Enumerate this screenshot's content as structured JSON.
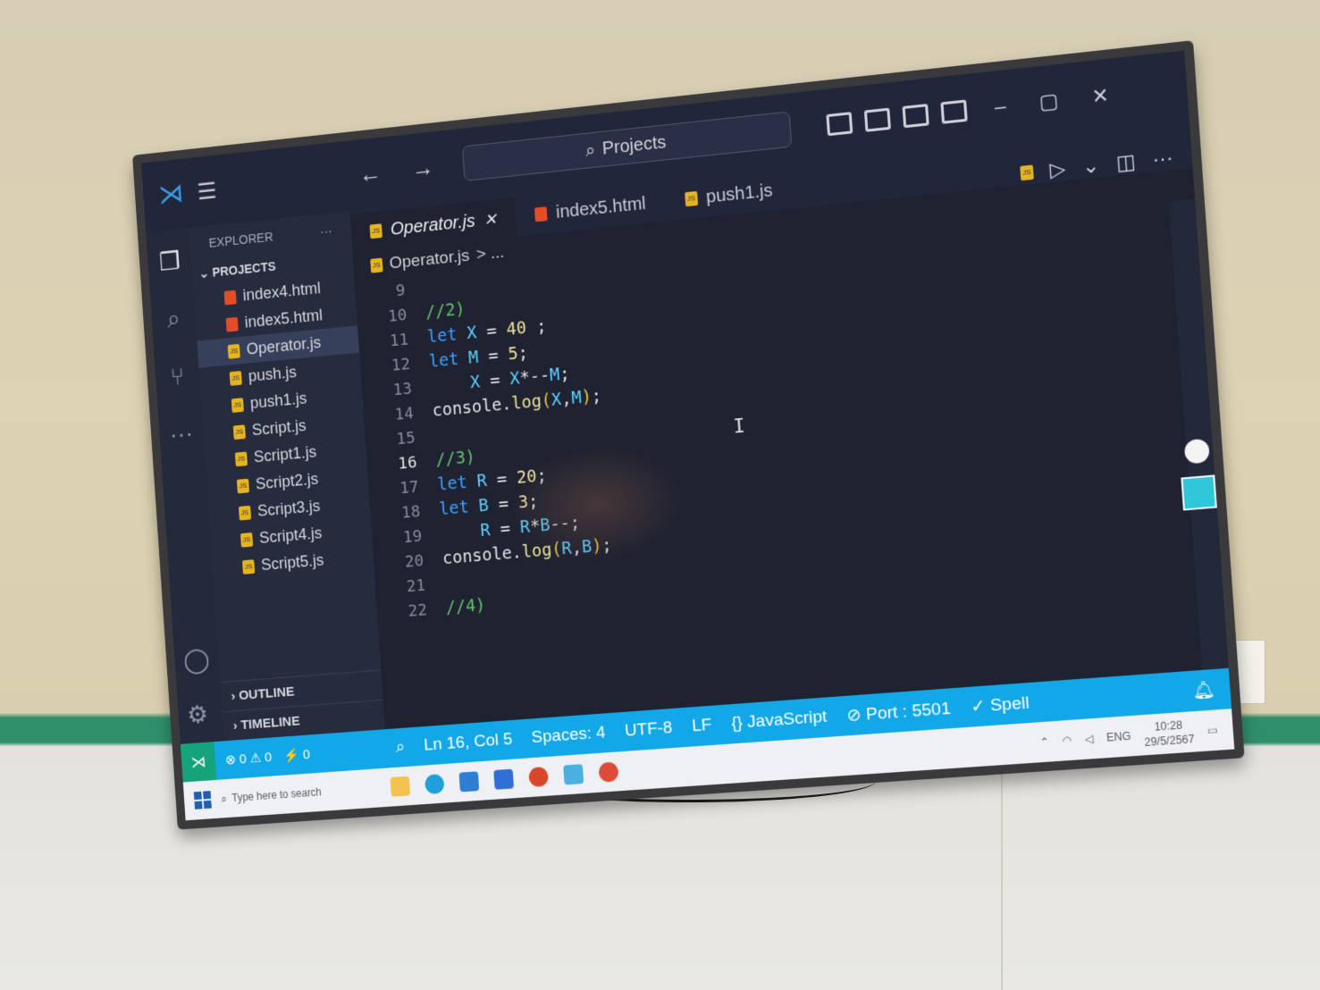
{
  "window": {
    "search_label": "Projects",
    "nav_arrows": "← →",
    "win_controls": [
      "–",
      "▢",
      "✕"
    ]
  },
  "explorer": {
    "title": "EXPLORER",
    "more": "···",
    "section": "PROJECTS",
    "files": [
      {
        "name": "index4.html",
        "type": "html"
      },
      {
        "name": "index5.html",
        "type": "html"
      },
      {
        "name": "Operator.js",
        "type": "js",
        "selected": true
      },
      {
        "name": "push.js",
        "type": "js"
      },
      {
        "name": "push1.js",
        "type": "js"
      },
      {
        "name": "Script.js",
        "type": "js"
      },
      {
        "name": "Script1.js",
        "type": "js"
      },
      {
        "name": "Script2.js",
        "type": "js"
      },
      {
        "name": "Script3.js",
        "type": "js"
      },
      {
        "name": "Script4.js",
        "type": "js"
      },
      {
        "name": "Script5.js",
        "type": "js"
      }
    ],
    "outline": "OUTLINE",
    "timeline": "TIMELINE"
  },
  "tabs": [
    {
      "label": "Operator.js",
      "close": "✕",
      "active": true
    },
    {
      "label": "index5.html"
    },
    {
      "label": "push1.js"
    }
  ],
  "breadcrumb": {
    "file": "Operator.js",
    "rest": "> ..."
  },
  "editor": {
    "lines": [
      {
        "n": "9",
        "parts": []
      },
      {
        "n": "10",
        "parts": [
          [
            "cmt",
            "//2)"
          ]
        ]
      },
      {
        "n": "11",
        "parts": [
          [
            "kw",
            "let "
          ],
          [
            "var",
            "X"
          ],
          [
            "",
            " = "
          ],
          [
            "num",
            "40"
          ],
          [
            "",
            " ;"
          ]
        ]
      },
      {
        "n": "12",
        "parts": [
          [
            "kw",
            "let "
          ],
          [
            "var",
            "M"
          ],
          [
            "",
            " = "
          ],
          [
            "num",
            "5"
          ],
          [
            "",
            ";"
          ]
        ]
      },
      {
        "n": "13",
        "parts": [
          [
            "",
            "    "
          ],
          [
            "var",
            "X"
          ],
          [
            "",
            " = "
          ],
          [
            "var",
            "X"
          ],
          [
            "",
            "*--"
          ],
          [
            "var",
            "M"
          ],
          [
            "",
            ";"
          ]
        ]
      },
      {
        "n": "14",
        "parts": [
          [
            "",
            "console."
          ],
          [
            "fn",
            "log"
          ],
          [
            "paren",
            "("
          ],
          [
            "var",
            "X"
          ],
          [
            "",
            ","
          ],
          [
            "var",
            "M"
          ],
          [
            "paren",
            ")"
          ],
          [
            "",
            ";"
          ]
        ]
      },
      {
        "n": "15",
        "parts": []
      },
      {
        "n": "16",
        "parts": [
          [
            "cmt",
            "//3)"
          ]
        ],
        "current": true
      },
      {
        "n": "17",
        "parts": [
          [
            "kw",
            "let "
          ],
          [
            "var",
            "R"
          ],
          [
            "",
            " = "
          ],
          [
            "num",
            "20"
          ],
          [
            "",
            ";"
          ]
        ]
      },
      {
        "n": "18",
        "parts": [
          [
            "kw",
            "let "
          ],
          [
            "var",
            "B"
          ],
          [
            "",
            " = "
          ],
          [
            "num",
            "3"
          ],
          [
            "",
            ";"
          ]
        ]
      },
      {
        "n": "19",
        "parts": [
          [
            "",
            "    "
          ],
          [
            "var",
            "R"
          ],
          [
            "",
            " = "
          ],
          [
            "var",
            "R"
          ],
          [
            "",
            "*"
          ],
          [
            "var",
            "B"
          ],
          [
            "",
            "--;"
          ]
        ]
      },
      {
        "n": "20",
        "parts": [
          [
            "",
            "console."
          ],
          [
            "fn",
            "log"
          ],
          [
            "paren",
            "("
          ],
          [
            "var",
            "R"
          ],
          [
            "",
            ","
          ],
          [
            "var",
            "B"
          ],
          [
            "paren",
            ")"
          ],
          [
            "",
            ";"
          ]
        ]
      },
      {
        "n": "21",
        "parts": []
      },
      {
        "n": "22",
        "parts": [
          [
            "cmt",
            "//4)"
          ]
        ]
      }
    ]
  },
  "status": {
    "problems": "⊗ 0  ⚠ 0",
    "ports": "⚡ 0",
    "position": "Ln 16, Col 5",
    "spaces": "Spaces: 4",
    "encoding": "UTF-8",
    "eol": "LF",
    "language": "{} JavaScript",
    "port": "⊘ Port : 5501",
    "spell": "✓ Spell"
  },
  "taskbar": {
    "search_placeholder": "Type here to search",
    "lang": "ENG",
    "time": "10:28",
    "date": "29/5/2567"
  },
  "colors": {
    "accent": "#12a8e8",
    "editor_bg": "#1f2230",
    "remote": "#15a37b"
  }
}
